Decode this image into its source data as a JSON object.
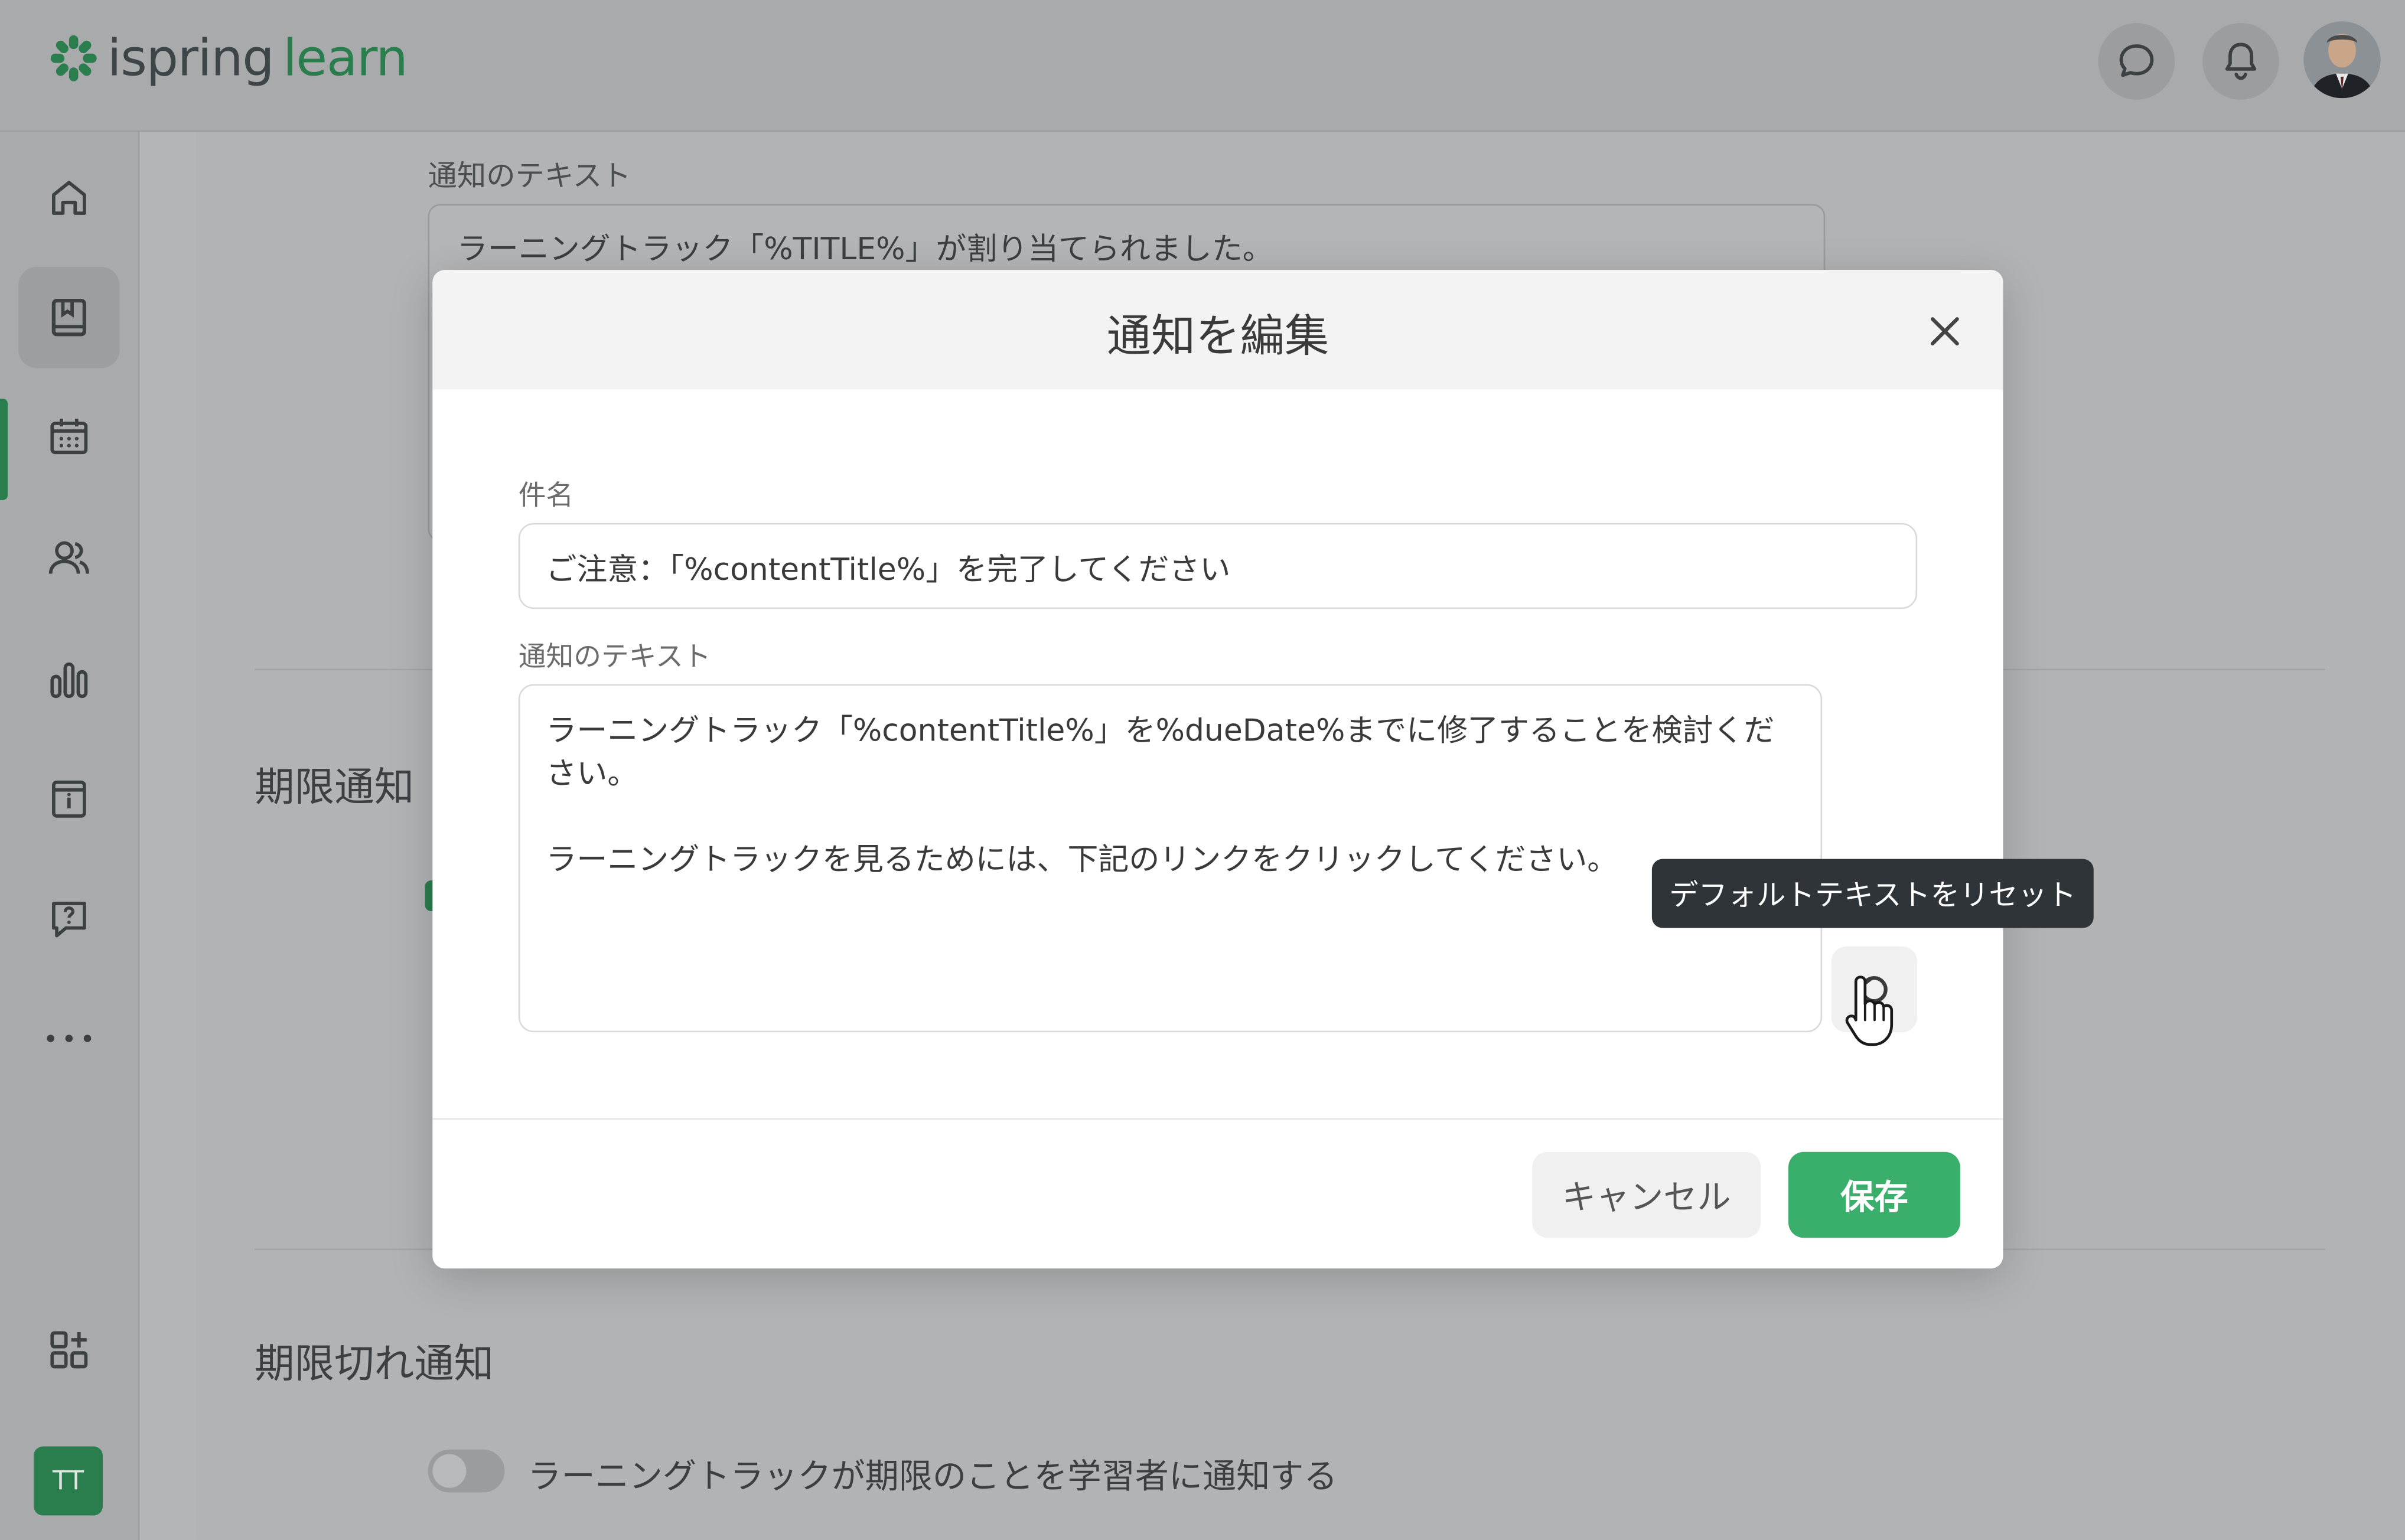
{
  "app": {
    "logo_primary": "ispring",
    "logo_secondary": "learn",
    "brand_color": "#2a7d4d",
    "accent_color": "#3aaf6c"
  },
  "header": {
    "icons": [
      "chat-icon",
      "bell-icon"
    ],
    "avatar": "user-avatar"
  },
  "sidebar": {
    "items": [
      {
        "icon": "home-icon"
      },
      {
        "icon": "book-icon",
        "active": true
      },
      {
        "icon": "calendar-icon"
      },
      {
        "icon": "users-icon"
      },
      {
        "icon": "bar-chart-icon"
      },
      {
        "icon": "info-icon"
      },
      {
        "icon": "help-icon"
      },
      {
        "icon": "more-icon"
      }
    ],
    "bottom_icon": "add-widget-icon",
    "user_badge": "TT"
  },
  "background": {
    "notification_text_label": "通知のテキスト",
    "notification_text_value": "ラーニングトラック「%TITLE%」が割り当てられました。",
    "due_notification_heading": "期限通知",
    "overdue_notification_heading": "期限切れ通知",
    "overdue_toggle_label": "ラーニングトラックが期限のことを学習者に通知する"
  },
  "modal": {
    "title": "通知を編集",
    "subject_label": "件名",
    "subject_value": "ご注意：「%contentTitle%」を完了してください",
    "body_label": "通知のテキスト",
    "body_value": "ラーニングトラック「%contentTitle%」を%dueDate%までに修了することを検討ください。\n\nラーニングトラックを見るためには、下記のリンクをクリックしてください。",
    "reset_tooltip": "デフォルトテキストをリセット",
    "cancel_label": "キャンセル",
    "save_label": "保存"
  }
}
